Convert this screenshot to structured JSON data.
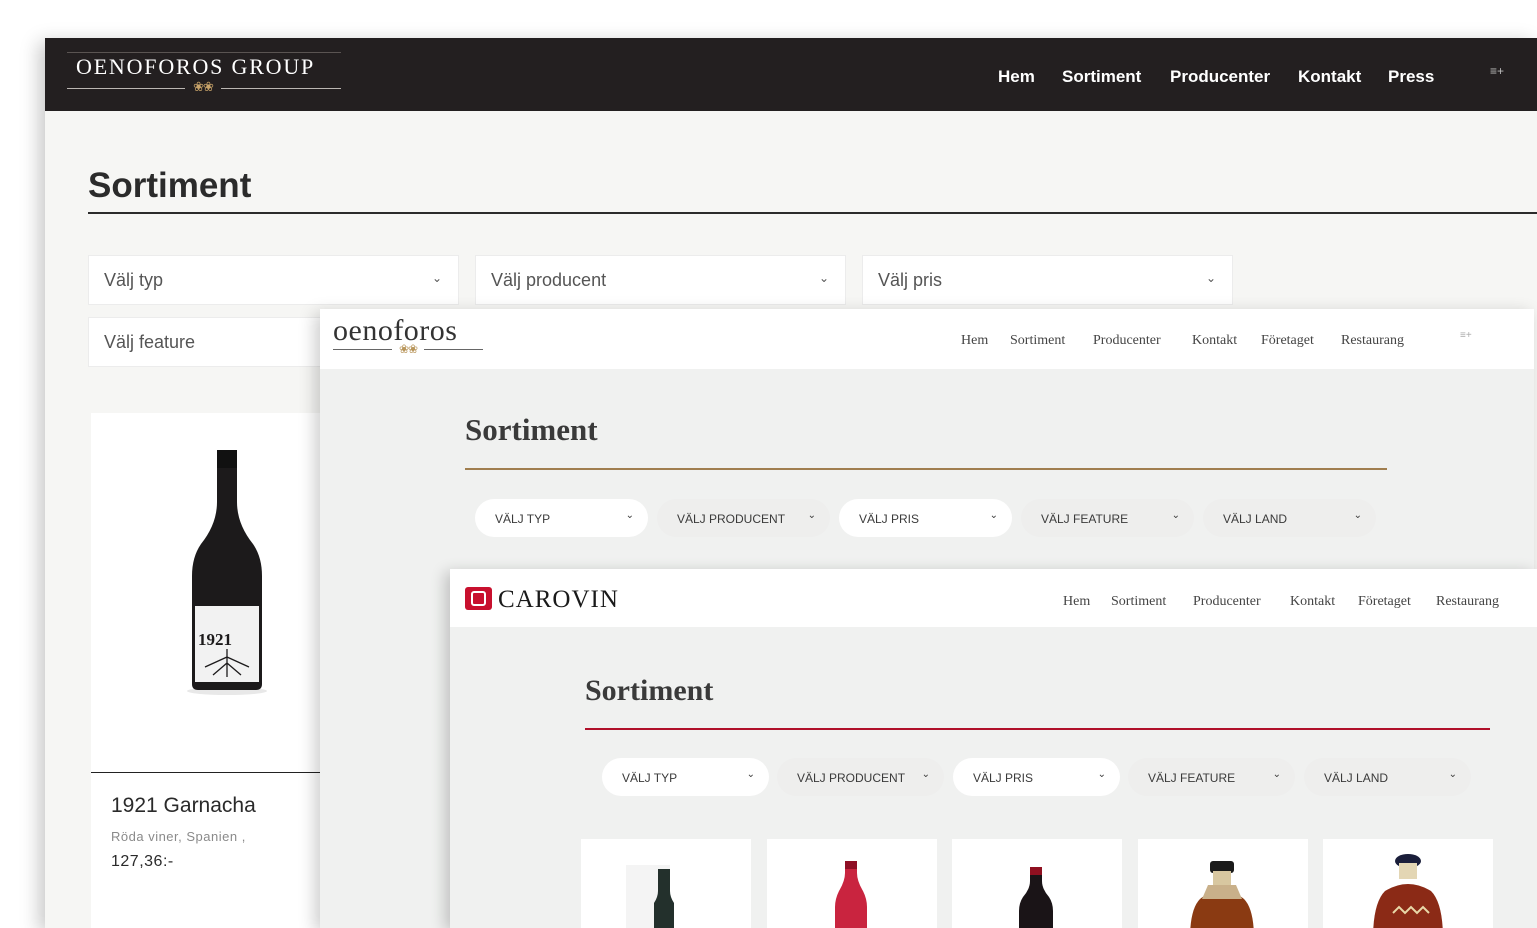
{
  "win1": {
    "logo": "OENOFOROS GROUP",
    "nav": [
      "Hem",
      "Sortiment",
      "Producenter",
      "Kontakt",
      "Press"
    ],
    "menu_icon": "menu-plus-icon",
    "page_title": "Sortiment",
    "filters": {
      "typ": "Välj typ",
      "producent": "Välj producent",
      "pris": "Välj pris",
      "feature": "Välj feature"
    },
    "product": {
      "name": "1921 Garnacha",
      "meta": "Röda viner, Spanien ,",
      "price": "127,36:-",
      "label_text": "1921"
    }
  },
  "win2": {
    "logo": "oenoforos",
    "nav": [
      "Hem",
      "Sortiment",
      "Producenter",
      "Kontakt",
      "Företaget",
      "Restaurang"
    ],
    "page_title": "Sortiment",
    "filters": [
      "VÄLJ TYP",
      "VÄLJ PRODUCENT",
      "VÄLJ PRIS",
      "VÄLJ FEATURE",
      "VÄLJ LAND"
    ]
  },
  "win3": {
    "logo": "CAROVIN",
    "nav": [
      "Hem",
      "Sortiment",
      "Producenter",
      "Kontakt",
      "Företaget",
      "Restaurang"
    ],
    "page_title": "Sortiment",
    "filters": [
      "VÄLJ TYP",
      "VÄLJ PRODUCENT",
      "VÄLJ PRIS",
      "VÄLJ FEATURE",
      "VÄLJ LAND"
    ]
  },
  "colors": {
    "dark_header": "#231f20",
    "gold": "#c9a46a",
    "oenoforos_rule": "#a07e4f",
    "carovin_red": "#c8102e"
  }
}
